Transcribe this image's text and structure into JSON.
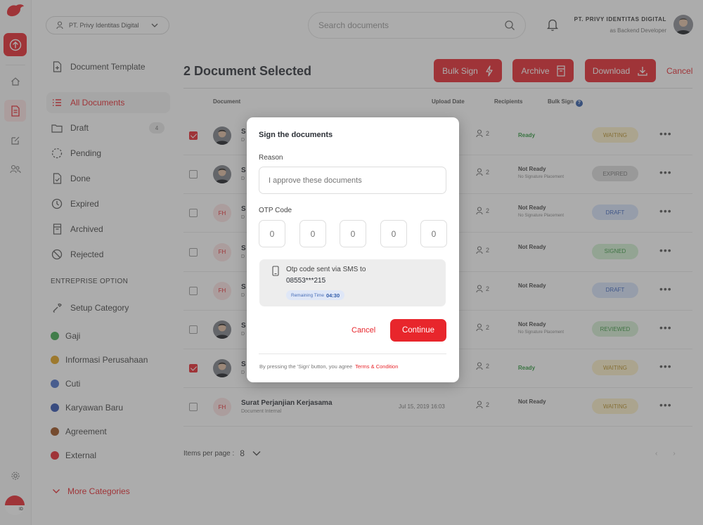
{
  "topbar": {
    "org_name": "PT. Privy Identitas Digital",
    "search_placeholder": "Search documents",
    "company_name": "PT. PRIVY IDENTITAS DIGITAL",
    "user_role": "as Backend Developer"
  },
  "rail": {
    "language": "ID"
  },
  "sidebar": {
    "template": "Document Template",
    "items": [
      {
        "label": "All Documents",
        "icon": "list-icon",
        "active": true
      },
      {
        "label": "Draft",
        "icon": "folder-icon",
        "count": "4"
      },
      {
        "label": "Pending",
        "icon": "dashed-circle-icon"
      },
      {
        "label": "Done",
        "icon": "document-check-icon"
      },
      {
        "label": "Expired",
        "icon": "clock-icon"
      },
      {
        "label": "Archived",
        "icon": "archive-icon"
      },
      {
        "label": "Rejected",
        "icon": "ban-icon"
      }
    ],
    "section_title": "ENTREPRISE OPTION",
    "setup_category": "Setup Category",
    "categories": [
      {
        "label": "Gaji",
        "color": "#3daa4e"
      },
      {
        "label": "Informasi Perusahaan",
        "color": "#e3a21a"
      },
      {
        "label": "Cuti",
        "color": "#4a6fc9"
      },
      {
        "label": "Karyawan Baru",
        "color": "#2f50b0"
      },
      {
        "label": "Agreement",
        "color": "#9c4f1c"
      },
      {
        "label": "External",
        "color": "#e8262c"
      }
    ],
    "more_categories": "More Categories"
  },
  "main": {
    "title": "2 Document Selected",
    "buttons": {
      "bulk_sign": "Bulk Sign",
      "archive": "Archive",
      "download": "Download",
      "cancel": "Cancel"
    },
    "columns": {
      "document": "Document",
      "upload_date": "Upload Date",
      "recipients": "Recipients",
      "bulk_sign": "Bulk Sign"
    },
    "rows": [
      {
        "checked": true,
        "avatar": "photo",
        "name": "S",
        "type": "D",
        "date": "",
        "recipients": "2",
        "bulk": "Ready",
        "bulk_note": "",
        "status": "WAITING"
      },
      {
        "checked": false,
        "avatar": "photo",
        "name": "S",
        "type": "D",
        "date": "",
        "recipients": "2",
        "bulk": "Not Ready",
        "bulk_note": "No Signature Placement",
        "status": "EXPIRED"
      },
      {
        "checked": false,
        "avatar": "FH",
        "name": "S",
        "type": "D",
        "date": "",
        "recipients": "2",
        "bulk": "Not Ready",
        "bulk_note": "No Signature Placement",
        "status": "DRAFT"
      },
      {
        "checked": false,
        "avatar": "FH",
        "name": "S",
        "type": "D",
        "date": "",
        "recipients": "2",
        "bulk": "Not Ready",
        "bulk_note": "",
        "status": "SIGNED"
      },
      {
        "checked": false,
        "avatar": "FH",
        "name": "S",
        "type": "D",
        "date": "",
        "recipients": "2",
        "bulk": "Not Ready",
        "bulk_note": "",
        "status": "DRAFT"
      },
      {
        "checked": false,
        "avatar": "photo",
        "name": "S",
        "type": "D",
        "date": "",
        "recipients": "2",
        "bulk": "Not Ready",
        "bulk_note": "No Signature Placement",
        "status": "REVIEWED"
      },
      {
        "checked": true,
        "avatar": "photo",
        "name": "S",
        "type": "D",
        "date": "",
        "recipients": "2",
        "bulk": "Ready",
        "bulk_note": "",
        "status": "WAITING"
      },
      {
        "checked": false,
        "avatar": "FH",
        "name": "Surat Perjanjian Kerjasama",
        "type": "Document Internal",
        "date": "Jul 15, 2019 16:03",
        "recipients": "2",
        "bulk": "Not Ready",
        "bulk_note": "",
        "status": "WAITING"
      }
    ],
    "status_colors": {
      "WAITING": {
        "bg": "#fdf0c9",
        "fg": "#b99128"
      },
      "EXPIRED": {
        "bg": "#dcdcdc",
        "fg": "#777777"
      },
      "DRAFT": {
        "bg": "#d7e3fb",
        "fg": "#3e66bf"
      },
      "SIGNED": {
        "bg": "#d2f0d2",
        "fg": "#3a9a43"
      },
      "REVIEWED": {
        "bg": "#d5efd3",
        "fg": "#3e9a45"
      }
    },
    "pager": {
      "label": "Items per page :",
      "value": "8"
    }
  },
  "modal": {
    "title": "Sign the documents",
    "reason_label": "Reason",
    "reason_placeholder": "I approve these documents",
    "otp_label": "OTP Code",
    "otp_digits": [
      "0",
      "0",
      "0",
      "0",
      "0"
    ],
    "sms_text": "Otp code sent via SMS to",
    "phone": "08553***215",
    "remaining_label": "Remaining Time",
    "remaining_time": "04:30",
    "cancel": "Cancel",
    "continue": "Continue",
    "footer_text": "By pressing the 'Sign' button, you agree",
    "footer_link": "Terms & Condition"
  }
}
